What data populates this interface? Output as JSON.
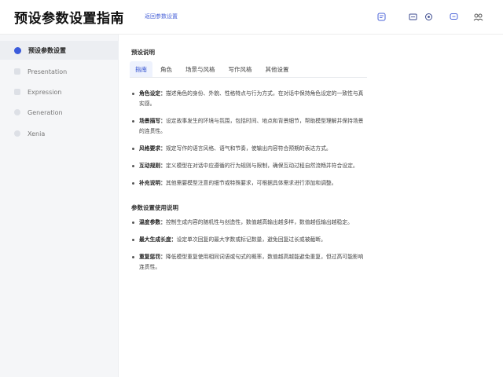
{
  "header": {
    "title": "预设参数设置指南",
    "link": "返回参数设置"
  },
  "sidebar": {
    "items": [
      {
        "label": "预设参数设置",
        "active": true
      },
      {
        "label": "Presentation"
      },
      {
        "label": "Expression"
      },
      {
        "label": "Generation"
      },
      {
        "label": "Xenia"
      }
    ]
  },
  "main": {
    "section1_title": "预设说明",
    "tabs": [
      "指南",
      "角色",
      "场景与风格",
      "写作风格",
      "其他设置"
    ],
    "list1": [
      {
        "term": "角色设定：",
        "text": "描述角色的身份、外貌、性格特点与行为方式，在对话中保持角色设定的一致性与真实感。"
      },
      {
        "term": "场景描写：",
        "text": "设定故事发生的环境与氛围，包括时间、地点和背景细节，帮助模型理解并保持场景的连贯性。"
      },
      {
        "term": "风格要求：",
        "text": "规定写作的语言风格、语气和节奏，使输出内容符合预期的表达方式。"
      },
      {
        "term": "互动规则：",
        "text": "定义模型在对话中应遵循的行为规则与限制，确保互动过程自然流畅并符合设定。"
      },
      {
        "term": "补充说明：",
        "text": "其他需要模型注意的细节或特殊要求，可根据具体需求进行添加和调整。"
      }
    ],
    "section2_title": "参数设置使用说明",
    "list2": [
      {
        "term": "温度参数：",
        "text": "控制生成内容的随机性与创造性，数值越高输出越多样，数值越低输出越稳定。"
      },
      {
        "term": "最大生成长度：",
        "text": "设定单次回复的最大字数或标记数量，避免回复过长或被截断。"
      },
      {
        "term": "重复惩罚：",
        "text": "降低模型重复使用相同词语或句式的概率，数值越高越能避免重复，但过高可能影响连贯性。"
      }
    ]
  },
  "icons": {
    "toolbar": [
      "note-icon",
      "window-icon",
      "circle-icon",
      "chat-icon",
      "users-icon"
    ]
  },
  "colors": {
    "accent": "#3b5bdb",
    "sidebar_bg": "#f5f6f8"
  }
}
